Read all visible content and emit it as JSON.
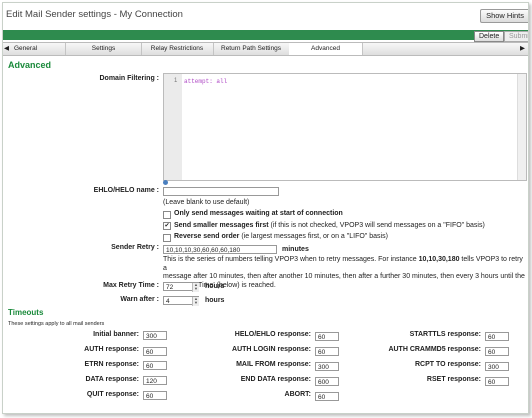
{
  "window_title": "Edit Mail Sender settings - My Connection",
  "show_hints_label": "Show Hints",
  "delete_label": "Delete",
  "submit_label": "Submit",
  "tabs": [
    "General",
    "Settings",
    "Relay Restrictions",
    "Return Path Settings",
    "Advanced"
  ],
  "advanced": {
    "title": "Advanced",
    "domain_filtering_label": "Domain Filtering :",
    "editor_line": "1",
    "editor_code": "attempt: all",
    "ehlo_label": "EHLO/HELO name :",
    "ehlo_value": "",
    "ehlo_hint": "(Leave blank to use default)",
    "only_send_bold": "Only send messages waiting at start of connection",
    "send_smaller_bold": "Send smaller messages first",
    "send_smaller_note": " (if this is not checked, VPOP3 will send messages on a \"FIFO\" basis)",
    "reverse_bold": "Reverse send order",
    "reverse_note": " (ie largest messages first, or on a \"LIFO\" basis)",
    "sender_retry_label": "Sender Retry :",
    "sender_retry_value": "10,10,10,30,60,60,60,180",
    "sender_retry_unit": "minutes",
    "retry_desc_1": "This is the series of numbers telling VPOP3 when to retry messages. For instance ",
    "retry_desc_example": "10,10,30,180",
    "retry_desc_2": " tells VPOP3 to retry a",
    "retry_desc_3": "message after 10 minutes, then after another 10 minutes, then after a further 30 minutes, then every 3 hours until the",
    "retry_desc_4": "'Max Retry Time' (below) is reached.",
    "max_retry_label": "Max Retry Time :",
    "max_retry_value": "72",
    "max_retry_unit": "hours",
    "warn_after_label": "Warn after :",
    "warn_after_value": "4",
    "warn_after_unit": "hours"
  },
  "timeouts": {
    "title": "Timeouts",
    "note": "These settings apply to all mail senders",
    "col1": [
      {
        "label": "Initial banner:",
        "value": "300"
      },
      {
        "label": "AUTH response:",
        "value": "60"
      },
      {
        "label": "ETRN response:",
        "value": "60"
      },
      {
        "label": "DATA response:",
        "value": "120"
      },
      {
        "label": "QUIT response:",
        "value": "60"
      }
    ],
    "col2": [
      {
        "label": "HELO/EHLO response:",
        "value": "60"
      },
      {
        "label": "AUTH LOGIN response:",
        "value": "60"
      },
      {
        "label": "MAIL FROM response:",
        "value": "300"
      },
      {
        "label": "END DATA response:",
        "value": "600"
      },
      {
        "label": "ABORT:",
        "value": "60"
      }
    ],
    "col3": [
      {
        "label": "STARTTLS response:",
        "value": "60"
      },
      {
        "label": "AUTH CRAMMD5 response:",
        "value": "60"
      },
      {
        "label": "RCPT TO response:",
        "value": "300"
      },
      {
        "label": "RSET response:",
        "value": "60"
      }
    ]
  }
}
